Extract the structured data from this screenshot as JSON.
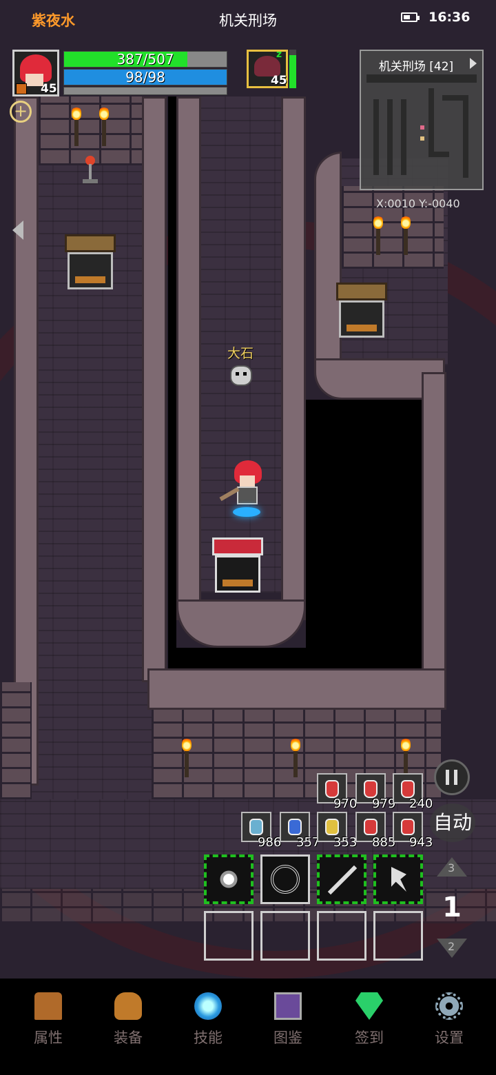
{
  "status": {
    "player_name": "紫夜水",
    "map_title": "机关刑场",
    "time": "16:36"
  },
  "player": {
    "level": "45",
    "hp": "387/507",
    "hp_fraction": 0.76,
    "mp": "98/98",
    "mp_fraction": 1.0
  },
  "companion": {
    "level": "45",
    "hp_fraction": 0.85
  },
  "minimap": {
    "title": "机关刑场 [42]",
    "coords": "X:0010  Y:-0040"
  },
  "npc": {
    "name": "大石"
  },
  "potions_row1": [
    "970",
    "979",
    "240"
  ],
  "potions_row2": [
    "986",
    "357",
    "353",
    "885",
    "943"
  ],
  "controls": {
    "auto_label": "自动",
    "floor_up": "3",
    "floor_current": "1",
    "floor_down": "2"
  },
  "nav": [
    {
      "label": "属性",
      "icon": "helmet-icon"
    },
    {
      "label": "装备",
      "icon": "pot-icon"
    },
    {
      "label": "技能",
      "icon": "orb-icon"
    },
    {
      "label": "图鉴",
      "icon": "book-icon"
    },
    {
      "label": "签到",
      "icon": "gem-icon"
    },
    {
      "label": "设置",
      "icon": "gear-icon"
    }
  ]
}
